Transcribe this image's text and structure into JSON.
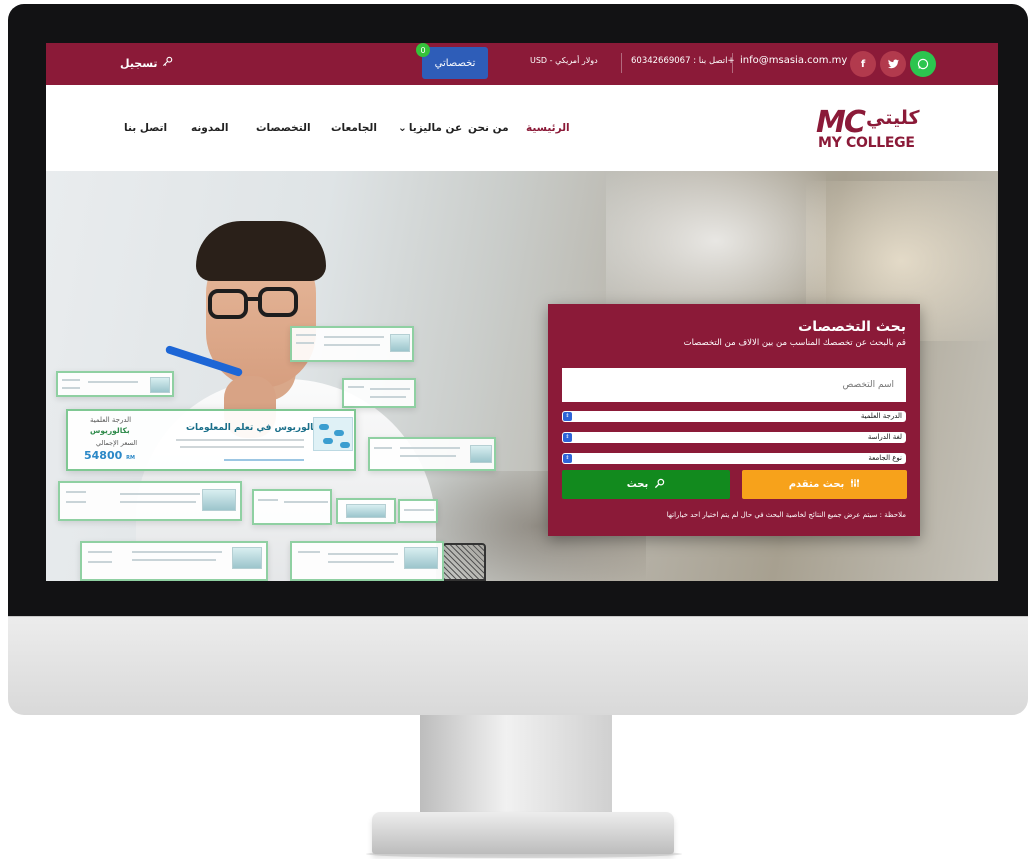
{
  "topbar": {
    "register_label": "تسجيل",
    "my_majors_label": "تخصصاتي",
    "my_majors_count": "0",
    "currency_label": "USD - دولار أمريكي",
    "phone_label": "اتصل بنا : 60342669067+",
    "email": "info@msasia.com.my"
  },
  "nav": {
    "items": [
      "الرئيسية",
      "من نحن",
      "عن ماليزيا",
      "الجامعات",
      "التخصصات",
      "المدونه",
      "اتصل بنا"
    ],
    "dropdown_caret": "⌄"
  },
  "logo": {
    "mark": "MC",
    "arabic": "كليتي",
    "english": "MY COLLEGE"
  },
  "hero_card": {
    "degree_label": "الدرجة العلمية",
    "degree_value": "بكالوريوس",
    "price_label": "السعر الإجمالي",
    "price_value": "54800",
    "price_unit": "RM",
    "title": "بكالوريوس في تعلم المعلومات"
  },
  "search": {
    "title": "بحث التخصصات",
    "subtitle": "قم بالبحث عن تخصصك المناسب من بين الالاف من التخصصات",
    "name_placeholder": "اسم التخصص",
    "selects": [
      "الدرجة العلمية",
      "لغة الدراسة",
      "نوع الجامعة"
    ],
    "advanced_label": "بحث متقدم",
    "search_label": "بحث",
    "note": "ملاحظة : سيتم عرض جميع النتائج لخاصية البحث في حال لم يتم اختيار احد خياراتها"
  },
  "colors": {
    "brand": "#8b1a38",
    "my_majors_button": "#2e5db8",
    "advanced_button": "#f7a21b",
    "search_button": "#128a1e",
    "whatsapp": "#2cc54f"
  },
  "icons": [
    "key-icon",
    "facebook-icon",
    "twitter-icon",
    "whatsapp-icon",
    "search-icon",
    "sliders-icon",
    "chevron-down-icon"
  ]
}
